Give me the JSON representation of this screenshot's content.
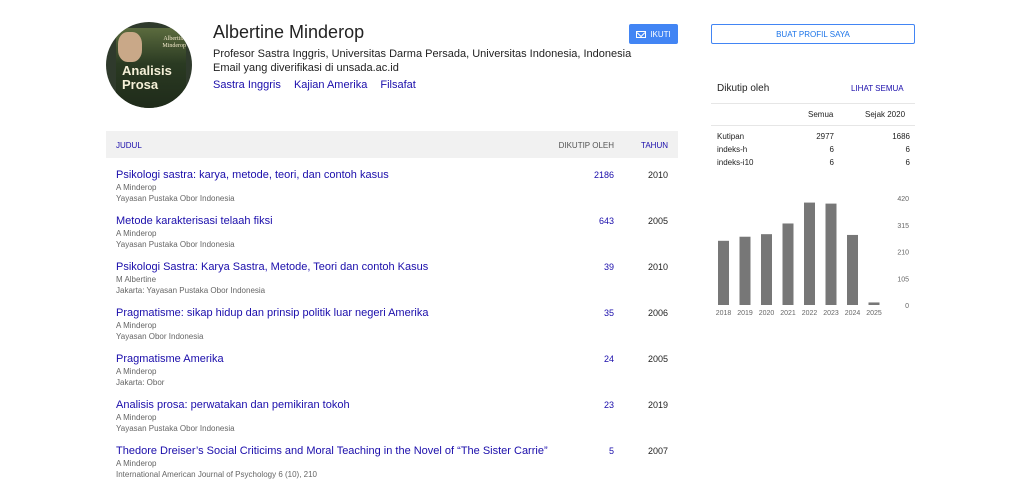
{
  "profile": {
    "name": "Albertine Minderop",
    "affiliation": "Profesor Sastra Inggris, Universitas Darma Persada, Universitas Indonesia, Indonesia",
    "email": "Email yang diverifikasi di unsada.ac.id",
    "interests": [
      "Sastra Inggris",
      "Kajian Amerika",
      "Filsafat"
    ],
    "avatar_text": {
      "top1": "Albertine",
      "top2": "Minderop",
      "big1": "Analisis",
      "big2": "Prosa"
    },
    "follow_label": "IKUTI"
  },
  "table": {
    "col_title": "JUDUL",
    "col_cited": "DIKUTIP OLEH",
    "col_year": "TAHUN",
    "rows": [
      {
        "title": "Psikologi sastra: karya, metode, teori, dan contoh kasus",
        "authors": "A Minderop",
        "venue": "Yayasan Pustaka Obor Indonesia",
        "cited": "2186",
        "year": "2010"
      },
      {
        "title": "Metode karakterisasi telaah fiksi",
        "authors": "A Minderop",
        "venue": "Yayasan Pustaka Obor Indonesia",
        "cited": "643",
        "year": "2005"
      },
      {
        "title": "Psikologi Sastra: Karya Sastra, Metode, Teori dan contoh Kasus",
        "authors": "M Albertine",
        "venue": "Jakarta: Yayasan Pustaka Obor Indonesia",
        "cited": "39",
        "year": "2010"
      },
      {
        "title": "Pragmatisme: sikap hidup dan prinsip politik luar negeri Amerika",
        "authors": "A Minderop",
        "venue": "Yayasan Obor Indonesia",
        "cited": "35",
        "year": "2006"
      },
      {
        "title": "Pragmatisme Amerika",
        "authors": "A Minderop",
        "venue": "Jakarta: Obor",
        "cited": "24",
        "year": "2005"
      },
      {
        "title": "Analisis prosa: perwatakan dan pemikiran tokoh",
        "authors": "A Minderop",
        "venue": "Yayasan Pustaka Obor Indonesia",
        "cited": "23",
        "year": "2019"
      },
      {
        "title": "Thedore Dreiser’s Social Criticims and Moral Teaching in the Novel of “The Sister Carrie”",
        "authors": "A Minderop",
        "venue": "International American Journal of Psychology 6 (10), 210",
        "cited": "5",
        "year": "2007"
      }
    ]
  },
  "sidebar": {
    "create_profile": "BUAT PROFIL SAYA",
    "cited_by": "Dikutip oleh",
    "see_all": "LIHAT SEMUA",
    "col_all": "Semua",
    "col_since": "Sejak 2020",
    "stats": [
      {
        "label": "Kutipan",
        "all": "2977",
        "since": "1686"
      },
      {
        "label": "indeks-h",
        "all": "6",
        "since": "6"
      },
      {
        "label": "indeks-i10",
        "all": "6",
        "since": "6"
      }
    ]
  },
  "colors": {
    "link": "#1a0dab",
    "bar": "#777777",
    "button": "#4285f4"
  },
  "chart_data": {
    "type": "bar",
    "categories": [
      "2018",
      "2019",
      "2020",
      "2021",
      "2022",
      "2023",
      "2024",
      "2025"
    ],
    "values": [
      252,
      268,
      278,
      320,
      402,
      398,
      275,
      10
    ],
    "yticks": [
      "420",
      "315",
      "210",
      "105",
      "0"
    ],
    "ylim": [
      0,
      420
    ]
  }
}
